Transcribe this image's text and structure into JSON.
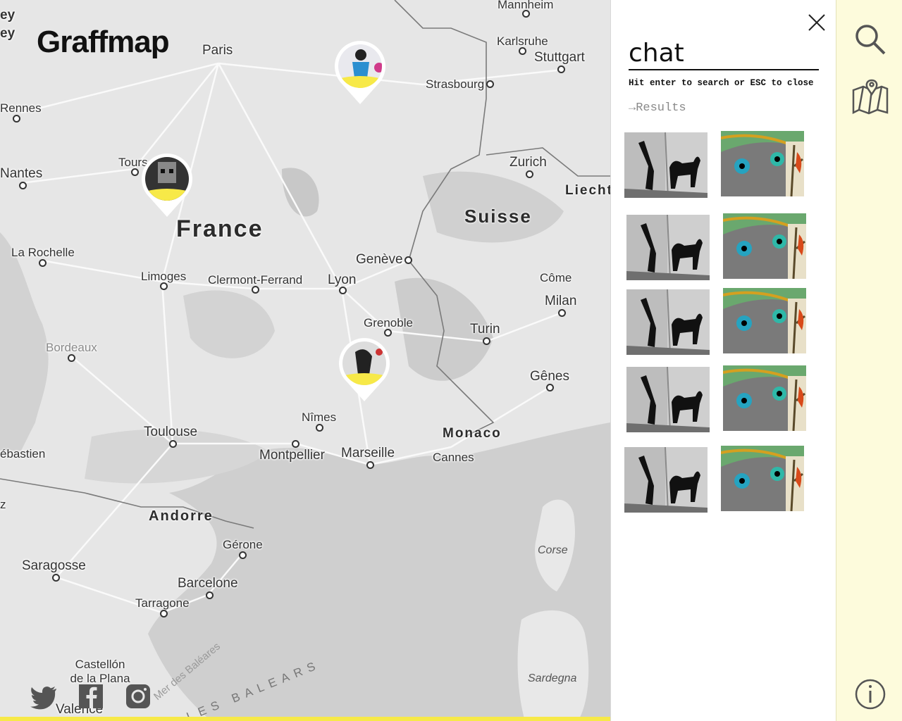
{
  "app": {
    "logo": "Graffmap"
  },
  "map": {
    "cities": [
      {
        "name": "Mannheim"
      },
      {
        "name": "Karlsruhe"
      },
      {
        "name": "Stuttgart"
      },
      {
        "name": "Paris"
      },
      {
        "name": "Strasbourg"
      },
      {
        "name": "Rennes"
      },
      {
        "name": "Tours"
      },
      {
        "name": "Nantes"
      },
      {
        "name": "Zurich"
      },
      {
        "name": "Liecht"
      },
      {
        "name": "La Rochelle"
      },
      {
        "name": "Limoges"
      },
      {
        "name": "Clermont-Ferrand"
      },
      {
        "name": "Lyon"
      },
      {
        "name": "Genève"
      },
      {
        "name": "Côme"
      },
      {
        "name": "Milan"
      },
      {
        "name": "Grenoble"
      },
      {
        "name": "Turin"
      },
      {
        "name": "Bordeaux"
      },
      {
        "name": "Gênes"
      },
      {
        "name": "Nîmes"
      },
      {
        "name": "Toulouse"
      },
      {
        "name": "Montpellier"
      },
      {
        "name": "Marseille"
      },
      {
        "name": "Cannes"
      },
      {
        "name": "ébastien"
      },
      {
        "name": "Gérone"
      },
      {
        "name": "Saragosse"
      },
      {
        "name": "Barcelone"
      },
      {
        "name": "Tarragone"
      },
      {
        "name": "Castellón de la Plana"
      },
      {
        "name": "Valence"
      },
      {
        "name": "ey"
      },
      {
        "name": "ey"
      },
      {
        "name": "z"
      }
    ],
    "countries": [
      {
        "name": "France"
      },
      {
        "name": "Suisse"
      },
      {
        "name": "Monaco"
      },
      {
        "name": "Andorre"
      }
    ],
    "islands": [
      {
        "name": "Corse"
      },
      {
        "name": "Sardegna"
      }
    ],
    "seas": [
      {
        "name": "Mer des Baléares"
      },
      {
        "name": "LES BALEARS"
      }
    ],
    "markers": [
      {
        "label": "graffiti-pin-paris-east"
      },
      {
        "label": "graffiti-pin-tours"
      },
      {
        "label": "graffiti-pin-provence"
      }
    ]
  },
  "social": [
    "twitter-icon",
    "facebook-icon",
    "instagram-icon"
  ],
  "search": {
    "value": "chat",
    "hint": "Hit enter to search or ESC to close",
    "results_label": "Results",
    "results_arrow": "→"
  },
  "results": [
    {
      "title": "cat-shadow-painting"
    },
    {
      "title": "cat-eyes-tree-painting"
    },
    {
      "title": "cat-shadow-painting"
    },
    {
      "title": "cat-eyes-tree-painting"
    },
    {
      "title": "cat-shadow-painting"
    },
    {
      "title": "cat-eyes-tree-painting"
    },
    {
      "title": "cat-shadow-painting"
    },
    {
      "title": "cat-eyes-tree-painting"
    },
    {
      "title": "cat-shadow-painting"
    },
    {
      "title": "cat-eyes-tree-painting"
    }
  ],
  "rail": {
    "buttons": [
      "search-icon",
      "map-icon",
      "info-icon"
    ]
  },
  "colors": {
    "accent_yellow": "#f7e948",
    "rail_bg": "#fdfbdc",
    "map_bg": "#e6e6e6"
  }
}
